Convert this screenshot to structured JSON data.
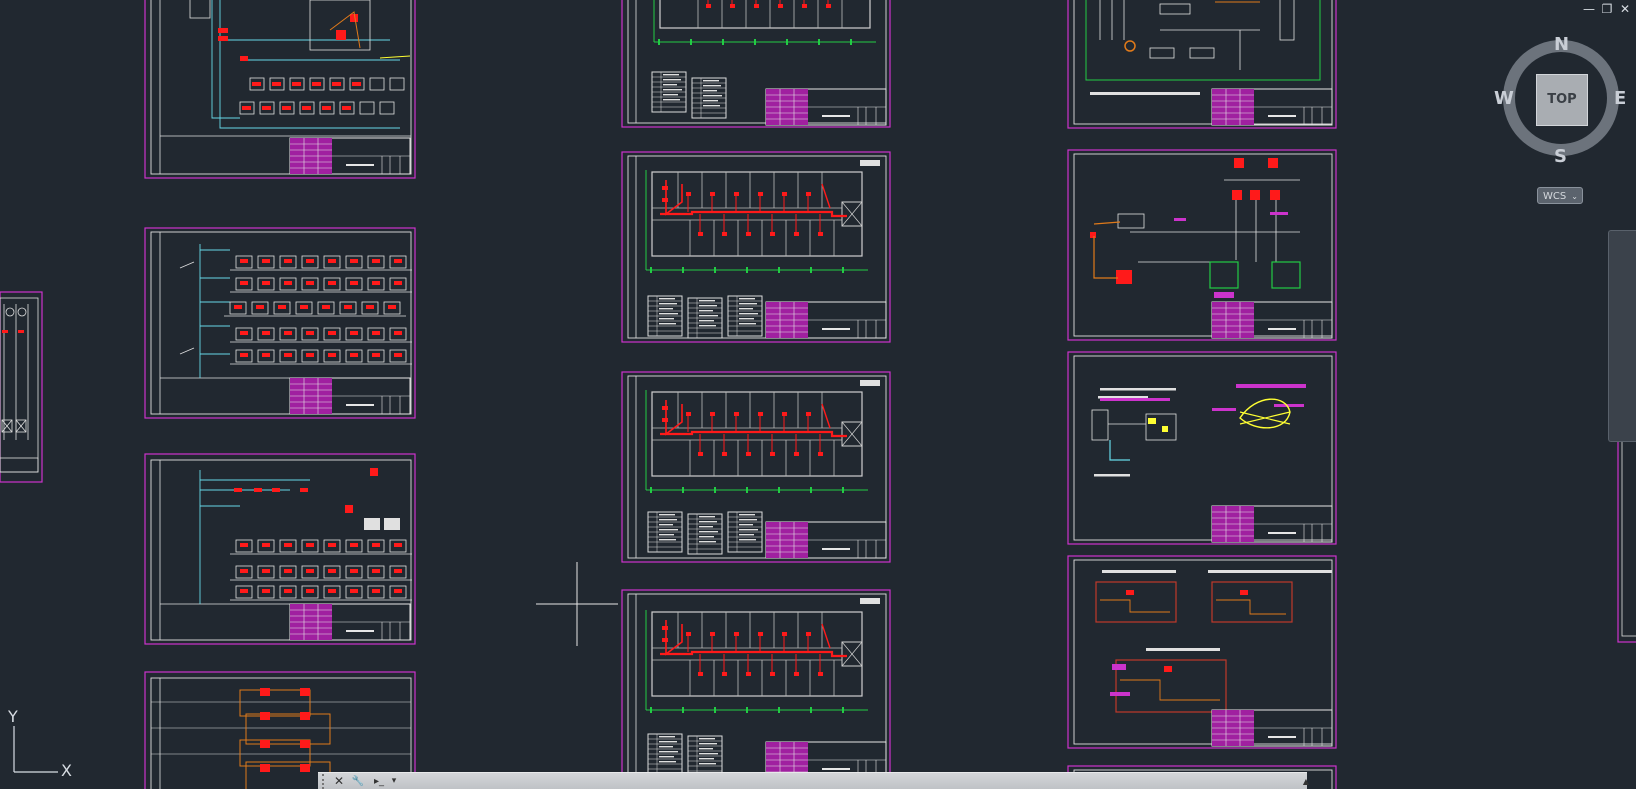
{
  "window_controls": {
    "minimize": "—",
    "restore": "❐",
    "close": "✕"
  },
  "viewcube": {
    "north": "N",
    "south": "S",
    "east": "E",
    "west": "W",
    "face": "TOP"
  },
  "wcs": {
    "label": "WCS",
    "caret": "⌄"
  },
  "ucs": {
    "x_label": "X",
    "y_label": "Y"
  },
  "command_line": {
    "close_icon": "✕",
    "settings_icon": "🔧",
    "prompt_icon": "▸_",
    "history_caret": "▾",
    "scroll_up": "▲"
  },
  "colors": {
    "background": "#212830",
    "sheet_border": "#cc33cc",
    "frame": "#e0e0e0",
    "wire_red": "#ff1a1a",
    "wire_cyan": "#66d9e8",
    "wire_green": "#22cc44",
    "wire_orange": "#e07a1a"
  }
}
